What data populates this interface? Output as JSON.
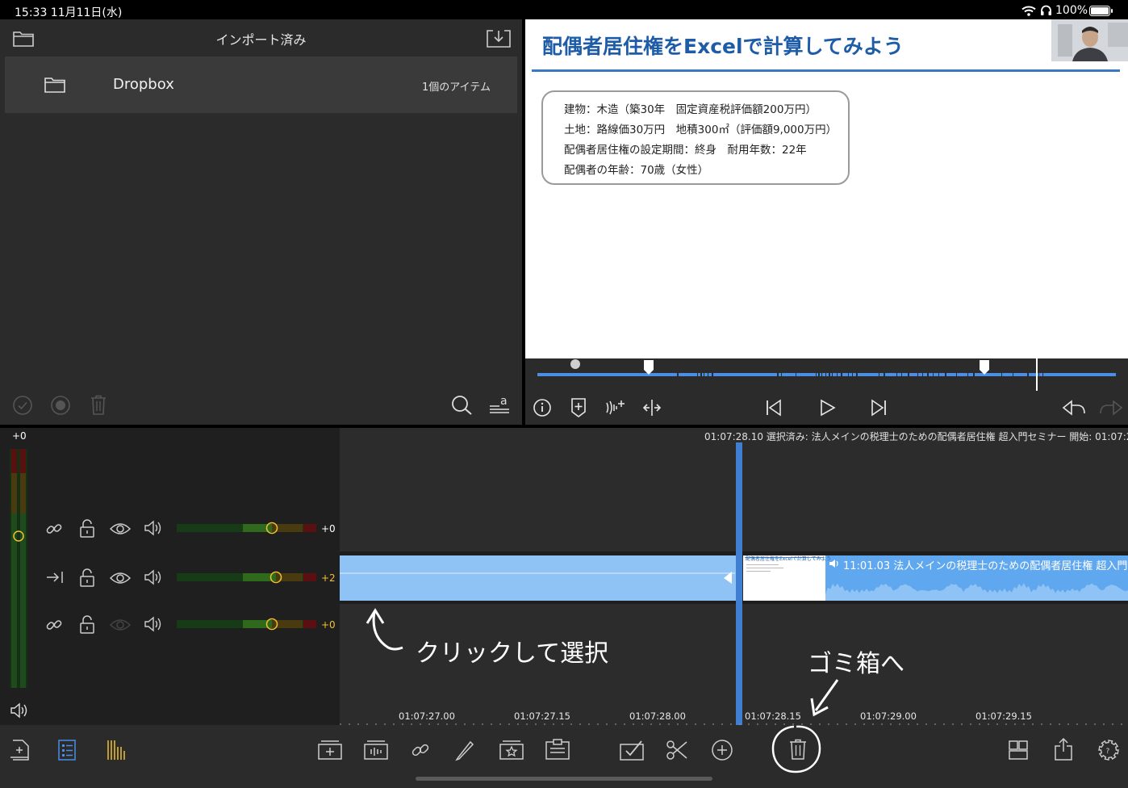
{
  "status_bar": {
    "time_date": "15:33   11月11日(水)",
    "battery": "100%"
  },
  "browser": {
    "title": "インポート済み",
    "items": [
      {
        "label": "Dropbox",
        "count": "1個のアイテム"
      }
    ]
  },
  "viewer": {
    "slide": {
      "title": "配偶者居住権をExcelで計算してみよう",
      "lines": [
        "建物：木造（築30年　固定資産税評価額200万円）",
        "土地：路線価30万円　地積300㎡（評価額9,000万円）",
        "配偶者居住権の設定期間：終身　耐用年数：22年",
        "配偶者の年齢：70歳（女性）"
      ]
    }
  },
  "timeline": {
    "info": "01:07:28.10 選択済み: 法人メインの税理士のための配偶者居住権 超入門セミナー 開始: 01:07:21...",
    "master_level": "+0",
    "tracks": [
      {
        "level": "+0",
        "level_color": "#ffffff",
        "level_fraction": 0.68
      },
      {
        "level": "+2",
        "level_color": "#f2c12e",
        "level_fraction": 0.71
      },
      {
        "level": "+0",
        "level_color": "#f2c12e",
        "level_fraction": 0.68
      }
    ],
    "clip": {
      "thumb_title": "配偶者居住権をExcelで計算してみよう",
      "label": "11:01.03  法人メインの税理士のための配偶者居住権 超入門"
    },
    "ruler": [
      "01:07:27.00",
      "01:07:27.15",
      "01:07:28.00",
      "01:07:28.15",
      "01:07:29.00",
      "01:07:29.15"
    ]
  },
  "annotations": {
    "click_select": "クリックして選択",
    "to_trash": "ゴミ箱へ"
  },
  "colors": {
    "accent_blue": "#4a8ee6",
    "selected_clip": "#8fc3f5",
    "slide_title": "#1f5ca8",
    "level_yellow": "#f2c12e"
  }
}
